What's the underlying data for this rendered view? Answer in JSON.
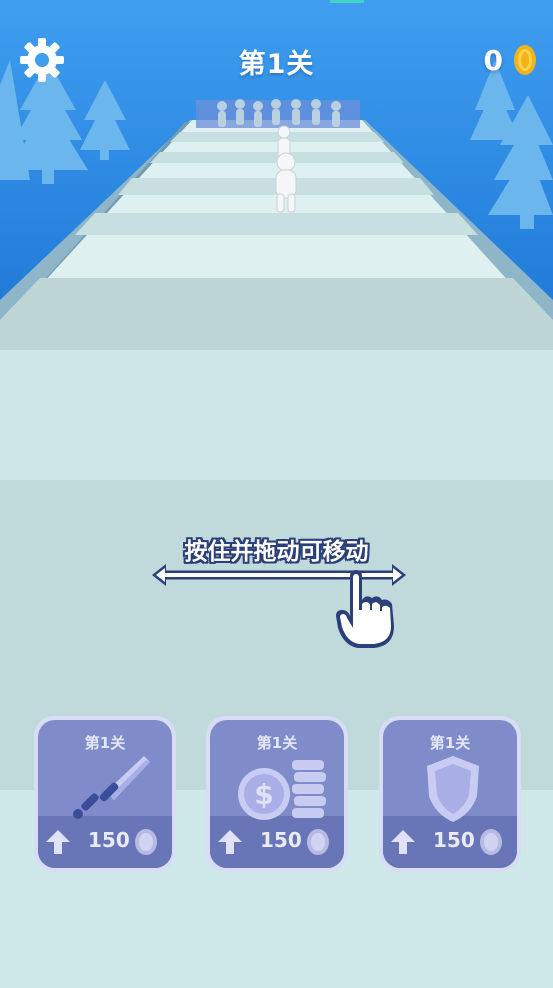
{
  "hud": {
    "level_label": "第1关",
    "coin_count": "0"
  },
  "tutorial": {
    "hint_text": "按住并拖动可移动"
  },
  "upgrades": [
    {
      "level_label": "第1关",
      "price": "150",
      "icon": "sword-icon"
    },
    {
      "level_label": "第1关",
      "price": "150",
      "icon": "coin-stack-icon"
    },
    {
      "level_label": "第1关",
      "price": "150",
      "icon": "shield-icon"
    }
  ],
  "colors": {
    "sky": "#4aa3ee",
    "snow": "#cfe9ea",
    "card": "#7f8cc9",
    "coin": "#f2b21c",
    "outline": "#2b3f7a"
  }
}
